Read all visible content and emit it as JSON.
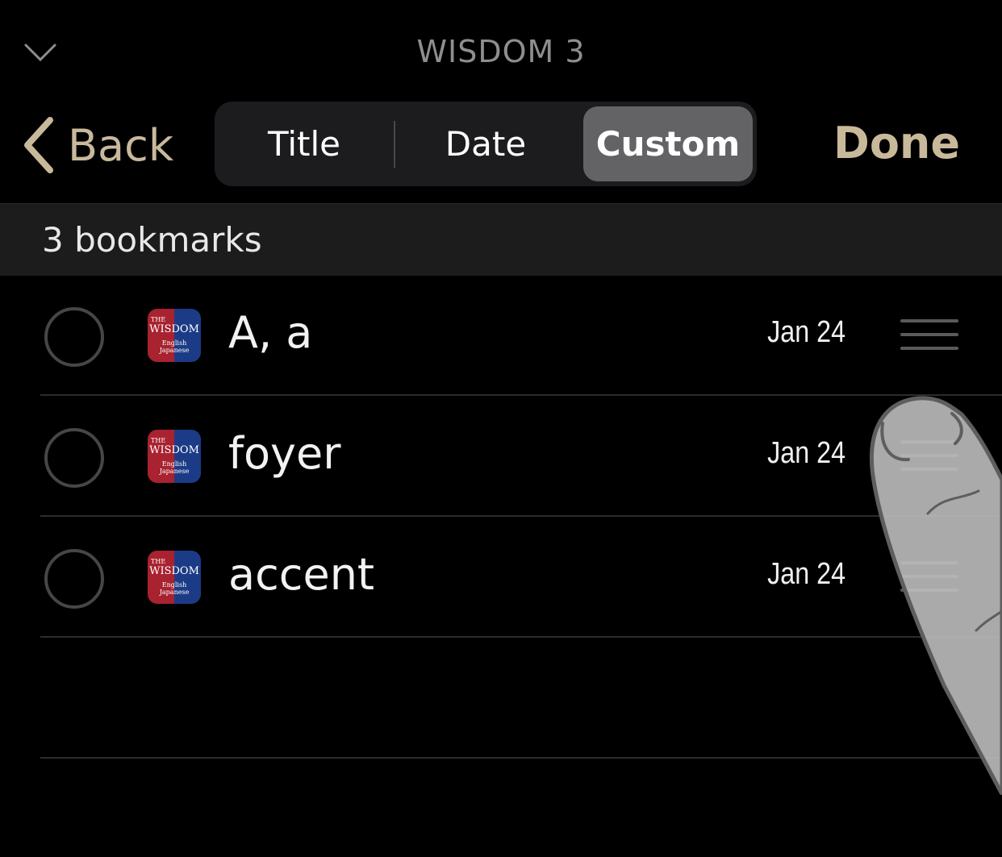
{
  "nav": {
    "title": "WISDOM 3",
    "back_label": "Back",
    "done_label": "Done"
  },
  "sort": {
    "options": [
      "Title",
      "Date",
      "Custom"
    ],
    "selected": "Custom"
  },
  "list": {
    "count_label": "3 bookmarks",
    "items": [
      {
        "word": "A, a",
        "date": "Jan 24"
      },
      {
        "word": "foyer",
        "date": "Jan 24"
      },
      {
        "word": "accent",
        "date": "Jan 24"
      }
    ],
    "app_icon": {
      "line1": "THE",
      "line2": "WISDOM",
      "line3": "English",
      "line4": "Japanese"
    }
  },
  "colors": {
    "accent": "#c9b99b",
    "selected_segment": "#636366",
    "icon_red": "#a8222f",
    "icon_blue": "#1c3b86"
  }
}
